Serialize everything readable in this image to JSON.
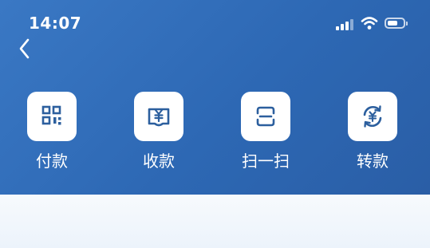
{
  "status_bar": {
    "time": "14:07",
    "icons": [
      "cellular-signal-icon",
      "wifi-icon",
      "battery-icon"
    ]
  },
  "nav": {
    "back_icon": "chevron-left-icon"
  },
  "actions": [
    {
      "label": "付款",
      "icon": "qr-code-icon"
    },
    {
      "label": "收款",
      "icon": "receive-yuan-icon"
    },
    {
      "label": "扫一扫",
      "icon": "scan-icon"
    },
    {
      "label": "转款",
      "icon": "transfer-yuan-icon"
    }
  ],
  "colors": {
    "header_bg": "#2f6db8",
    "icon_blue": "#2c5f9e",
    "tile_bg": "#ffffff",
    "label_text": "#ffffff"
  }
}
